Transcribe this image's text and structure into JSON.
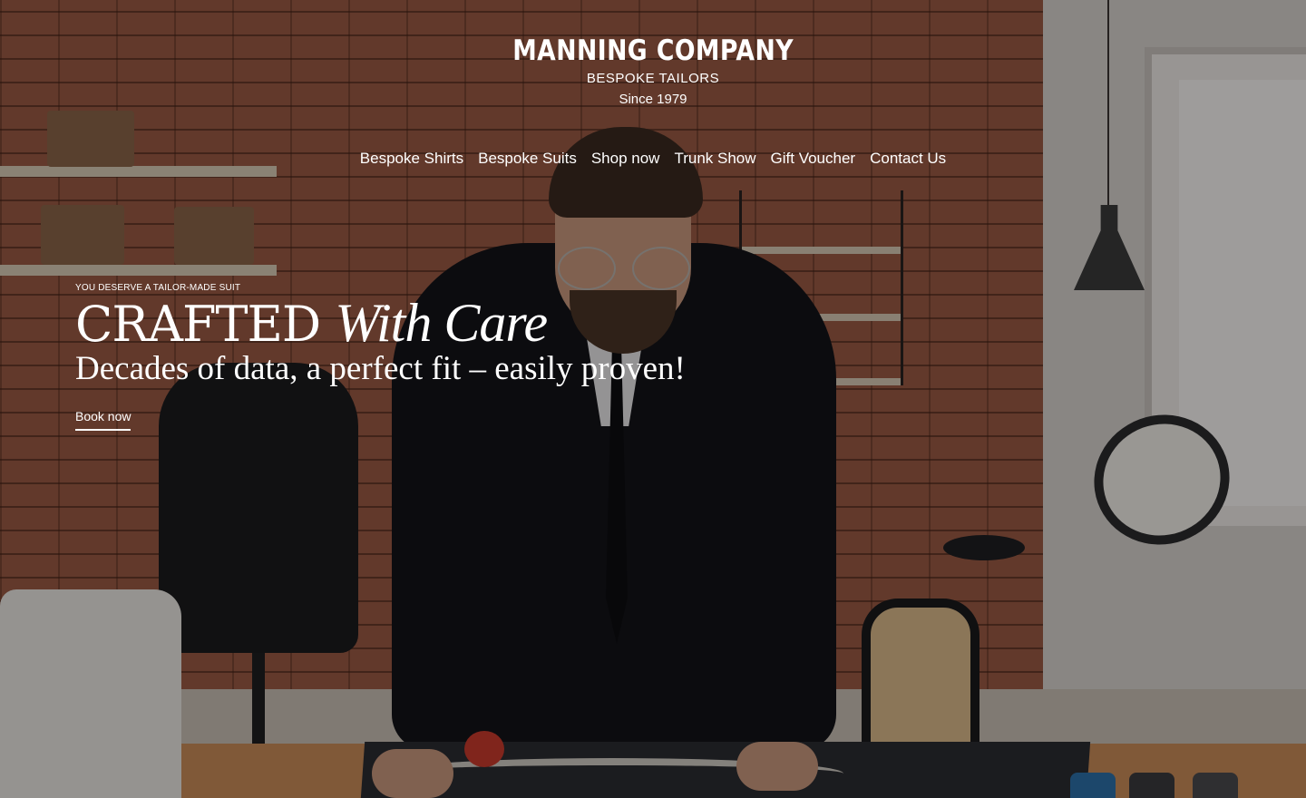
{
  "brand": {
    "name": "MANNING COMPANY",
    "subtitle": "BESPOKE TAILORS",
    "since": "Since 1979"
  },
  "nav": {
    "items": [
      {
        "label": "Bespoke Shirts"
      },
      {
        "label": "Bespoke Suits"
      },
      {
        "label": "Shop now"
      },
      {
        "label": "Trunk Show"
      },
      {
        "label": "Gift Voucher"
      },
      {
        "label": "Contact Us"
      }
    ]
  },
  "hero": {
    "eyebrow": "YOU DESERVE A TAILOR-MADE SUIT",
    "headline_main": "CRAFTED",
    "headline_script": "With Care",
    "tagline": "Decades of data, a perfect fit – easily proven!",
    "cta_label": "Book now",
    "background_image": "tailor-workshop-photo"
  },
  "colors": {
    "text": "#ffffff",
    "overlay": "rgba(0,0,0,0.36)",
    "brick": "#9a5a44"
  }
}
